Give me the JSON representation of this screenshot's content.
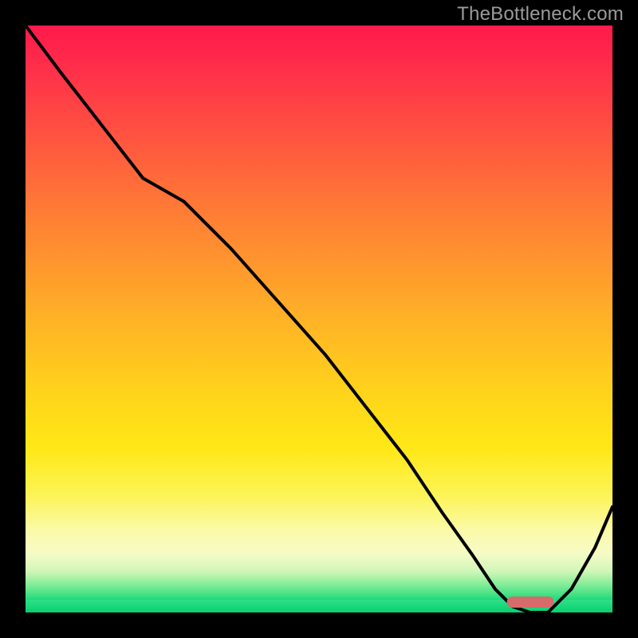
{
  "watermark": "TheBottleneck.com",
  "chart_data": {
    "type": "line",
    "title": "",
    "xlabel": "",
    "ylabel": "",
    "xlim": [
      0,
      100
    ],
    "ylim": [
      0,
      100
    ],
    "grid": false,
    "legend": false,
    "series": [
      {
        "name": "bottleneck-curve",
        "color": "#000000",
        "x": [
          0,
          6,
          13,
          20,
          27,
          35,
          43,
          51,
          58,
          65,
          71,
          76,
          80,
          83,
          86,
          89,
          93,
          97,
          100
        ],
        "y": [
          100,
          92,
          83,
          74,
          70,
          62,
          53,
          44,
          35,
          26,
          17,
          10,
          4,
          1,
          0,
          0,
          4,
          11,
          18
        ]
      }
    ],
    "marker": {
      "name": "optimal-range",
      "x_range": [
        82,
        90
      ],
      "y": 0,
      "color": "#d76a6a"
    },
    "background_gradient": {
      "top_color": "#ff1a4a",
      "mid_color": "#ffd21c",
      "bottom_color": "#0bd273"
    }
  }
}
